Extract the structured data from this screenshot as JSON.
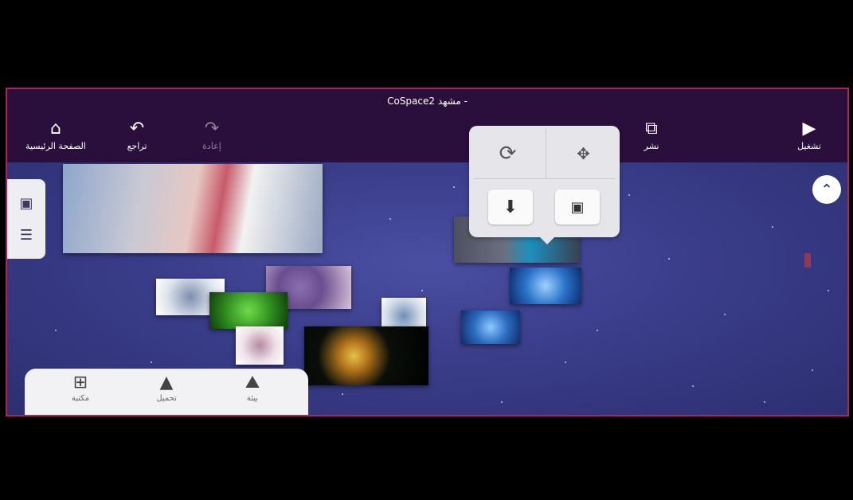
{
  "window": {
    "title": "CoSpace2 مشهد -"
  },
  "toolbar": {
    "home": {
      "label": "الصفحة الرئيسية",
      "icon": "home-icon"
    },
    "undo": {
      "label": "تراجع",
      "icon": "undo-icon"
    },
    "redo": {
      "label": "إعادة",
      "icon": "redo-icon"
    },
    "share": {
      "label": "نشر",
      "icon": "share-icon"
    },
    "play": {
      "label": "تشغيل",
      "icon": "play-icon"
    }
  },
  "transform_popover": {
    "rotate": {
      "icon": "rotate-icon"
    },
    "move": {
      "icon": "move-icon"
    },
    "drop": {
      "icon": "drop-to-floor-icon"
    },
    "resize": {
      "icon": "resize-icon"
    }
  },
  "side_panel": {
    "items": [
      {
        "icon": "image-icon"
      },
      {
        "icon": "list-icon"
      }
    ]
  },
  "dock": {
    "library": {
      "label": "مكتبة",
      "icon": "library-icon"
    },
    "upload": {
      "label": "تحميل",
      "icon": "upload-icon"
    },
    "environment": {
      "label": "بيئة",
      "icon": "environment-icon"
    }
  },
  "colors": {
    "topbar": "#2a0f3d",
    "frame_border": "#b0235a",
    "scene": "#3b3f8e"
  }
}
